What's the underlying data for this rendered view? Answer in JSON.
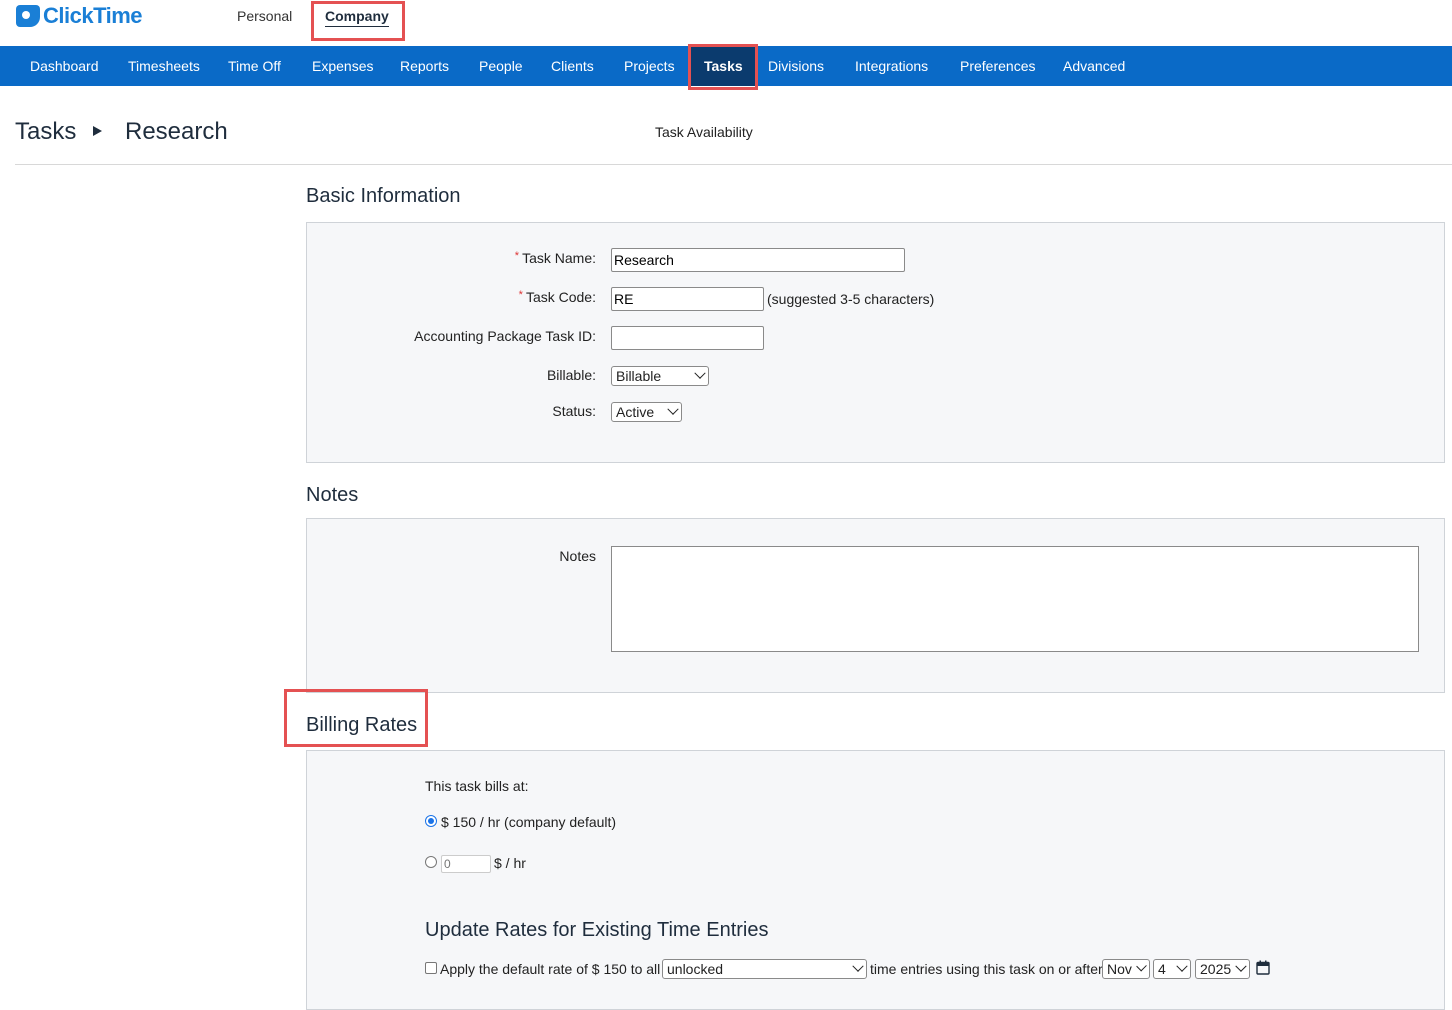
{
  "app": {
    "logo_text": "ClickTime"
  },
  "top_tabs": [
    "Personal",
    "Company"
  ],
  "nav": {
    "items": [
      "Dashboard",
      "Timesheets",
      "Time Off",
      "Expenses",
      "Reports",
      "People",
      "Clients",
      "Projects",
      "Tasks",
      "Divisions",
      "Integrations",
      "Preferences",
      "Advanced"
    ],
    "active": "Tasks"
  },
  "breadcrumb": {
    "root": "Tasks",
    "current": "Research"
  },
  "task_availability_link": "Task Availability",
  "basic_info": {
    "title": "Basic Information",
    "task_name_label": "Task Name:",
    "task_name_value": "Research",
    "task_code_label": "Task Code:",
    "task_code_value": "RE",
    "task_code_hint": "(suggested 3-5 characters)",
    "accounting_label": "Accounting Package Task ID:",
    "accounting_value": "",
    "billable_label": "Billable:",
    "billable_value": "Billable",
    "status_label": "Status:",
    "status_value": "Active"
  },
  "notes": {
    "title": "Notes",
    "label": "Notes",
    "value": ""
  },
  "billing": {
    "title": "Billing Rates",
    "intro": "This task bills at:",
    "default_option": "$ 150 / hr (company default)",
    "custom_placeholder": "0",
    "custom_unit": "$ / hr"
  },
  "update_rates": {
    "title": "Update Rates for Existing Time Entries",
    "apply_text": "Apply the default rate of $ 150 to all",
    "entries_select": "unlocked",
    "after_text": "time entries using this task on or after",
    "month": "Nov",
    "day": "4",
    "year": "2025"
  },
  "colors": {
    "nav_bg": "#0a6ac7",
    "nav_active": "#0b3b6e",
    "highlight": "#e45152",
    "brand": "#1a7fd6"
  }
}
